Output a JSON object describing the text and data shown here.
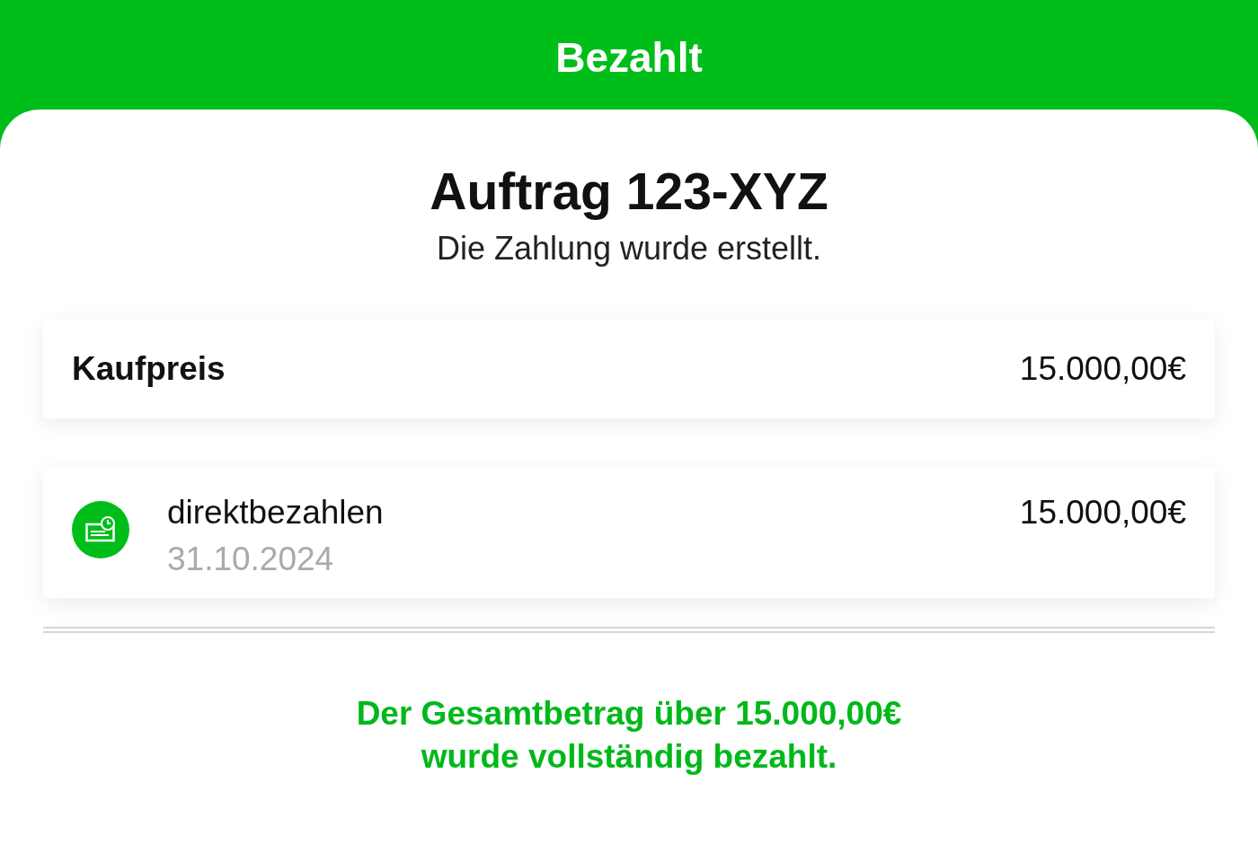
{
  "header": {
    "title": "Bezahlt"
  },
  "order": {
    "title": "Auftrag 123-XYZ",
    "subtitle": "Die Zahlung wurde erstellt."
  },
  "price": {
    "label": "Kaufpreis",
    "amount": "15.000,00€"
  },
  "payments": [
    {
      "method": "direktbezahlen",
      "date": "31.10.2024",
      "amount": "15.000,00€"
    }
  ],
  "summary": "Der Gesamtbetrag über 15.000,00€\nwurde vollständig bezahlt."
}
